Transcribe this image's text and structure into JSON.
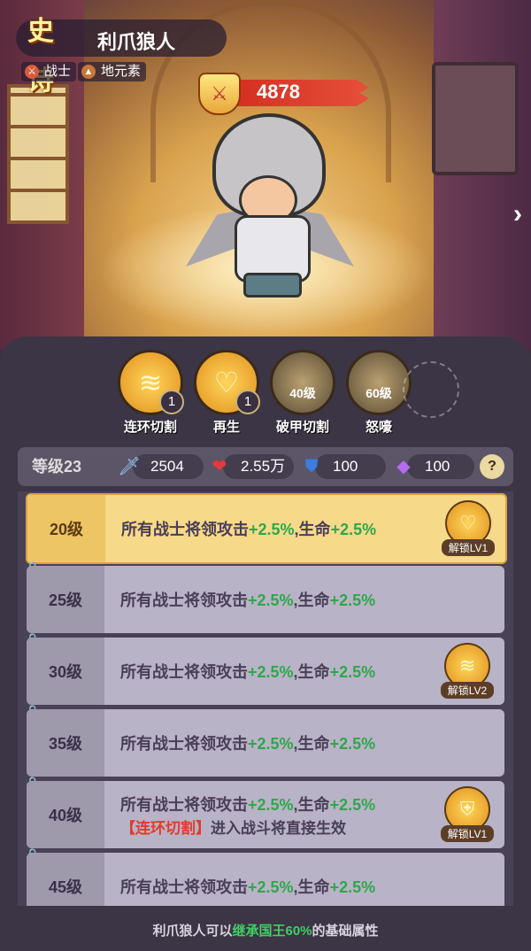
{
  "hero": {
    "rarity": "史诗",
    "name": "利爪狼人",
    "tags": [
      {
        "icon": "sword-icon",
        "label": "战士"
      },
      {
        "icon": "earth-element-icon",
        "label": "地元素"
      }
    ],
    "power": "4878"
  },
  "skills": [
    {
      "name": "连环切割",
      "level_badge": "1",
      "locked_level": "",
      "icon": "claw-slash-icon"
    },
    {
      "name": "再生",
      "level_badge": "1",
      "locked_level": "",
      "icon": "heart-icon"
    },
    {
      "name": "破甲切割",
      "level_badge": "",
      "locked_level": "40级",
      "icon": "armor-break-icon"
    },
    {
      "name": "怒嚎",
      "level_badge": "",
      "locked_level": "60级",
      "icon": "howl-icon"
    }
  ],
  "stats": {
    "level_label": "等级23",
    "attack": "2504",
    "health": "2.55万",
    "defense": "100",
    "magic": "100",
    "help": "?"
  },
  "rows": [
    {
      "level": "20级",
      "line1_prefix": "所有战士将领攻击",
      "atk": "+2.5%",
      "mid": ",生命",
      "hp": "+2.5%",
      "line2_tag": "",
      "line2_text": "",
      "unlock": "解锁LV1",
      "unlock_icon": "heart-icon",
      "active": true,
      "locked": false
    },
    {
      "level": "25级",
      "line1_prefix": "所有战士将领攻击",
      "atk": "+2.5%",
      "mid": ",生命",
      "hp": "+2.5%",
      "line2_tag": "",
      "line2_text": "",
      "unlock": "",
      "unlock_icon": "",
      "active": false,
      "locked": true
    },
    {
      "level": "30级",
      "line1_prefix": "所有战士将领攻击",
      "atk": "+2.5%",
      "mid": ",生命",
      "hp": "+2.5%",
      "line2_tag": "",
      "line2_text": "",
      "unlock": "解锁LV2",
      "unlock_icon": "claw-slash-icon",
      "active": false,
      "locked": true
    },
    {
      "level": "35级",
      "line1_prefix": "所有战士将领攻击",
      "atk": "+2.5%",
      "mid": ",生命",
      "hp": "+2.5%",
      "line2_tag": "",
      "line2_text": "",
      "unlock": "",
      "unlock_icon": "",
      "active": false,
      "locked": true
    },
    {
      "level": "40级",
      "line1_prefix": "所有战士将领攻击",
      "atk": "+2.5%",
      "mid": ",生命",
      "hp": "+2.5%",
      "line2_tag": "【连环切割】",
      "line2_text": "进入战斗将直接生效",
      "unlock": "解锁LV1",
      "unlock_icon": "armor-break-icon",
      "active": false,
      "locked": true
    },
    {
      "level": "45级",
      "line1_prefix": "所有战士将领攻击",
      "atk": "+2.5%",
      "mid": ",生命",
      "hp": "+2.5%",
      "line2_tag": "",
      "line2_text": "",
      "unlock": "",
      "unlock_icon": "",
      "active": false,
      "locked": true
    }
  ],
  "footer": {
    "prefix": "利爪狼人可以",
    "highlight": "继承国王60%",
    "suffix": "的基础属性"
  },
  "colors": {
    "accent_gold": "#f7d98a",
    "bonus_green": "#2ea84a",
    "tag_red": "#e03b2c",
    "power_red": "#d22a1e"
  }
}
